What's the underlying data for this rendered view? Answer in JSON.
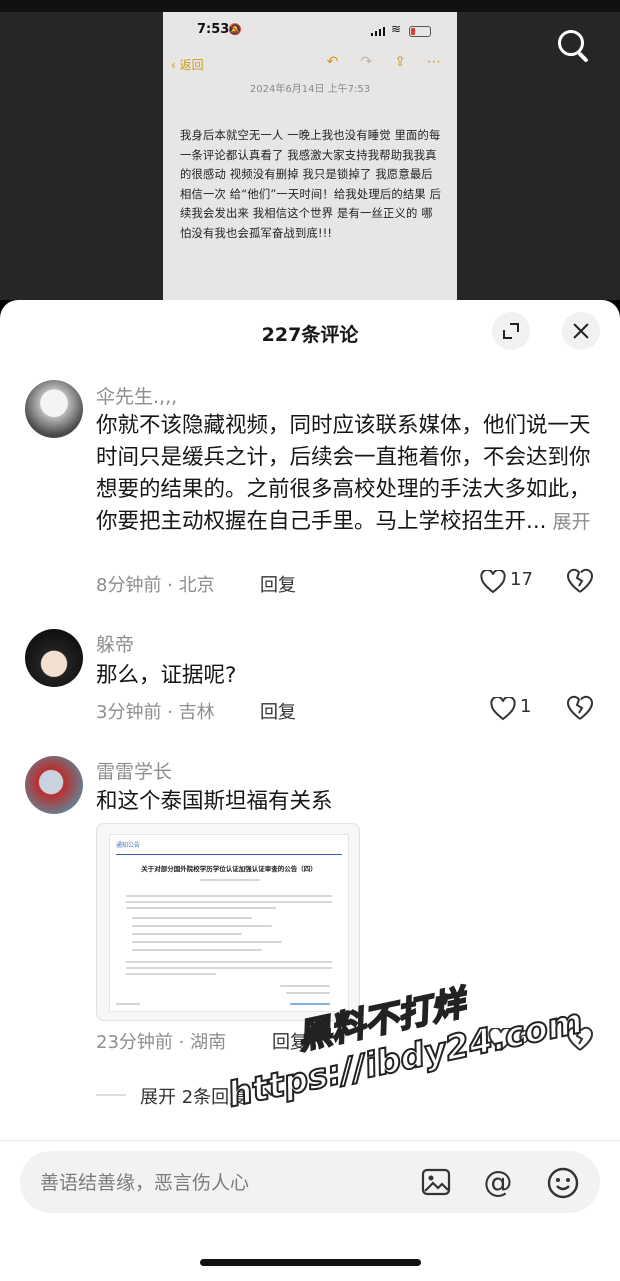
{
  "video": {
    "screenshot": {
      "time": "7:53",
      "back_label": "返回",
      "date": "2024年6月14日 上午7:53",
      "note_text": "我身后本就空无一人 一晚上我也没有睡觉 里面的每一条评论都认真看了 我感激大家支持我帮助我我真的很感动 视频没有删掉 我只是锁掉了 我愿意最后相信一次 给“他们”一天时间！给我处理后的结果 后续我会发出来 我相信这个世界 是有一丝正义的 哪怕没有我也会孤军奋战到底!!!"
    }
  },
  "sheet": {
    "title": "227条评论"
  },
  "comments": [
    {
      "username": "伞先生.,,,",
      "text": "你就不该隐藏视频，同时应该联系媒体，他们说一天时间只是缓兵之计，后续会一直拖着你，不会达到你想要的结果的。之前很多高校处理的手法大多如此，你要把主动权握在自己手里。马上学校招生开...",
      "more_label": "展开",
      "meta": "8分钟前 · 北京",
      "reply_label": "回复",
      "likes": "17"
    },
    {
      "username": "躲帝",
      "text": "那么，证据呢?",
      "meta": "3分钟前 · 吉林",
      "reply_label": "回复",
      "likes": "1"
    },
    {
      "username": "雷雷学长",
      "text": "和这个泰国斯坦福有关系",
      "meta": "23分钟前 · 湖南",
      "reply_label": "回复",
      "likes": "6",
      "attachment": {
        "header": "通知公告",
        "title": "关于对部分国外院校学历学位认证加强认证审查的公告（四）"
      }
    }
  ],
  "expand_replies_label": "展开 2条回复",
  "input": {
    "placeholder": "善语结善缘，恶言伤人心"
  },
  "watermark": {
    "line1": "黑料不打烊",
    "line2": "https://ibdy24.com"
  },
  "colors": {
    "accent_note": "#c89a1e",
    "secondary_text": "#8e8e8e"
  }
}
